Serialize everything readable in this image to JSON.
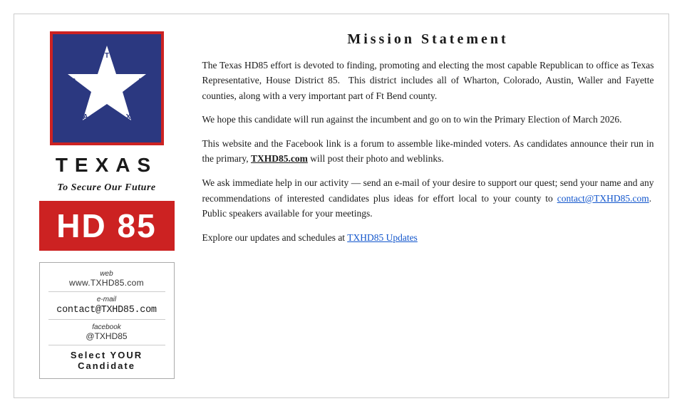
{
  "logo": {
    "alt": "Texas HD85 Star Logo",
    "state_label": "TEXAS",
    "tagline": "To Secure Our Future",
    "hd_badge": "HD 85"
  },
  "contact": {
    "web_label": "web",
    "web_url": "www.TXHD85.com",
    "email_label": "e-mail",
    "email": "contact@TXHD85.com",
    "facebook_label": "facebook",
    "facebook_handle": "@TXHD85",
    "cta": "Select YOUR Candidate"
  },
  "mission": {
    "title": "Mission Statement",
    "paragraphs": [
      "The Texas HD85 effort is devoted to finding, promoting and electing the most capable Republican to office as Texas Representative, House District 85.  This district includes all of Wharton, Colorado, Austin, Waller and Fayette counties, along with a very important part of Ft Bend county.",
      "We hope this candidate will run against the incumbent and go on to win the Primary Election of March 2026.",
      "This website and the Facebook link is a forum to assemble like-minded voters. As candidates announce their run in the primary, TXHD85.com will post their photo and weblinks.",
      "We ask immediate help in our activity — send an e-mail of your desire to support our quest; send your name and any recommendations of interested candidates plus ideas for effort local to your county to contact@TXHD85.com.  Public speakers available for your meetings.",
      "Explore our updates and schedules at TXHD85 Updates"
    ]
  }
}
